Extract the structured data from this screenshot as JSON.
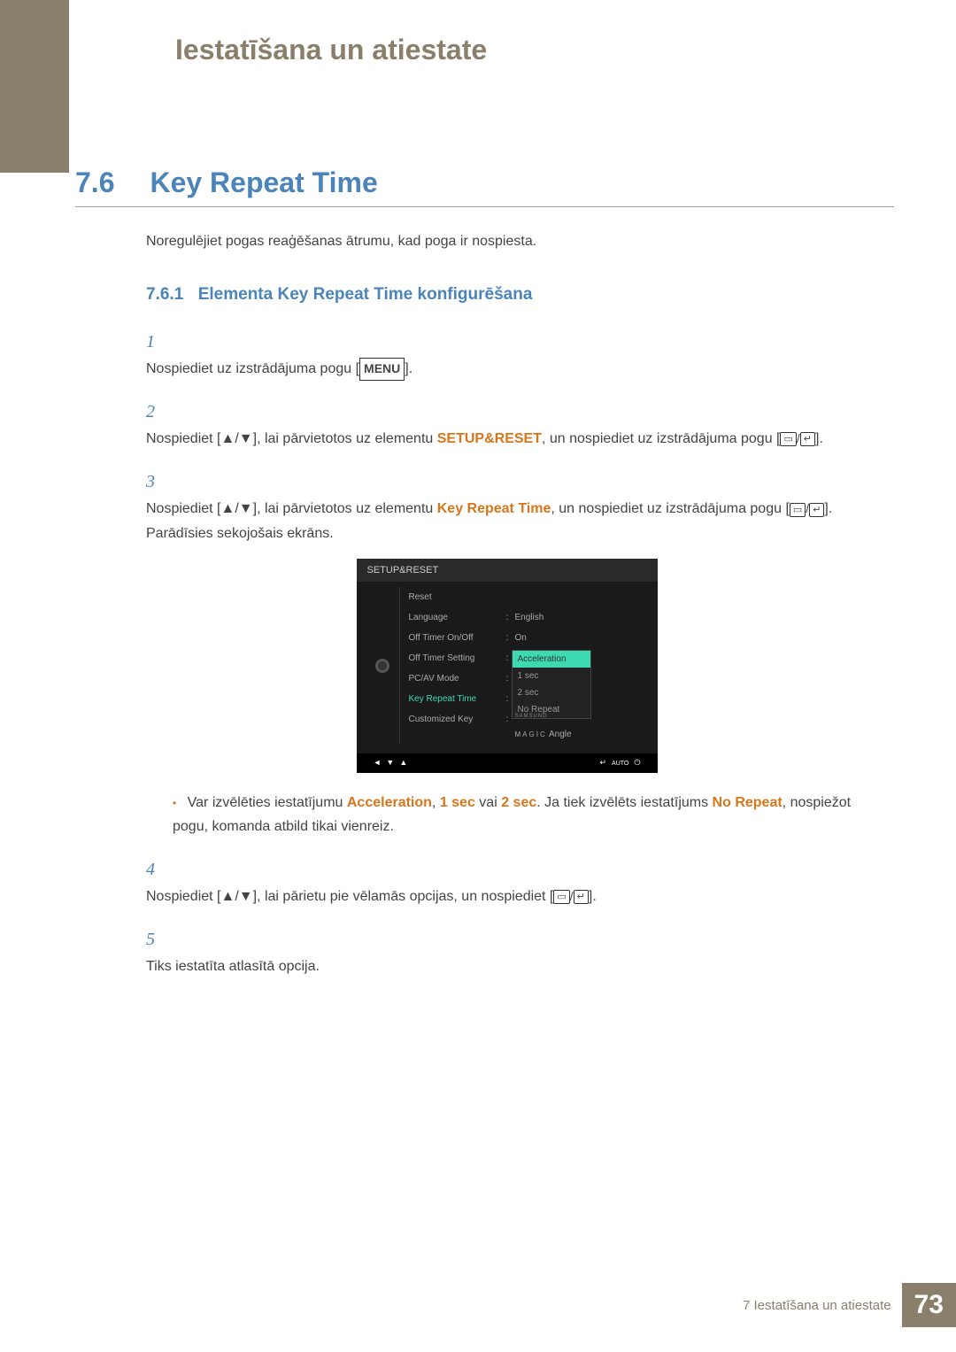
{
  "chapter_title": "Iestatīšana un atiestate",
  "section": {
    "num": "7.6",
    "title": "Key Repeat Time"
  },
  "intro": "Noregulējiet pogas reaģēšanas ātrumu, kad poga ir nospiesta.",
  "subsection": {
    "num": "7.6.1",
    "title": "Elementa Key Repeat Time konfigurēšana"
  },
  "steps": {
    "s1_a": "Nospiediet uz izstrādājuma pogu [",
    "menu_label": "MENU",
    "s1_b": "].",
    "s2_a": "Nospiediet [",
    "arrows": "▲/▼",
    "s2_b": "], lai pārvietotos uz elementu ",
    "s2_orange": "SETUP&RESET",
    "s2_c": ", un nospiediet uz izstrādājuma pogu [",
    "s2_d": "].",
    "s3_a": "Nospiediet [",
    "s3_b": "], lai pārvietotos uz elementu ",
    "s3_orange": "Key Repeat Time",
    "s3_c": ", un nospiediet uz izstrādājuma pogu [",
    "s3_d": "]. Parādīsies sekojošais ekrāns.",
    "bullet_a": "Var izvēlēties iestatījumu ",
    "bullet_accel": "Acceleration",
    "bullet_comma1": ", ",
    "bullet_1sec": "1 sec",
    "bullet_or": " vai ",
    "bullet_2sec": "2 sec",
    "bullet_b": ". Ja tiek izvēlēts iestatījums ",
    "bullet_norepeat": "No Repeat",
    "bullet_c": ", nospiežot pogu, komanda atbild tikai vienreiz.",
    "s4_a": "Nospiediet [",
    "s4_b": "], lai pārietu pie vēlamās opcijas, un nospiediet [",
    "s4_c": "].",
    "s5": "Tiks iestatīta atlasītā opcija."
  },
  "osd": {
    "header": "SETUP&RESET",
    "rows": {
      "reset": "Reset",
      "language": "Language",
      "language_v": "English",
      "offtimer": "Off Timer On/Off",
      "offtimer_v": "On",
      "offtimersetting": "Off Timer Setting",
      "pcav": "PC/AV Mode",
      "krt": "Key Repeat Time",
      "custom": "Customized Key"
    },
    "dropdown": {
      "accel": "Acceleration",
      "one": "1 sec",
      "two": "2 sec",
      "nr": "No Repeat"
    },
    "magic_sup": "SAMSUNG",
    "magic": "MAGIC",
    "magic_suffix": "Angle",
    "footer_auto": "AUTO"
  },
  "footer": {
    "crumb_prefix": "7",
    "crumb": "Iestatīšana un atiestate",
    "page": "73"
  }
}
